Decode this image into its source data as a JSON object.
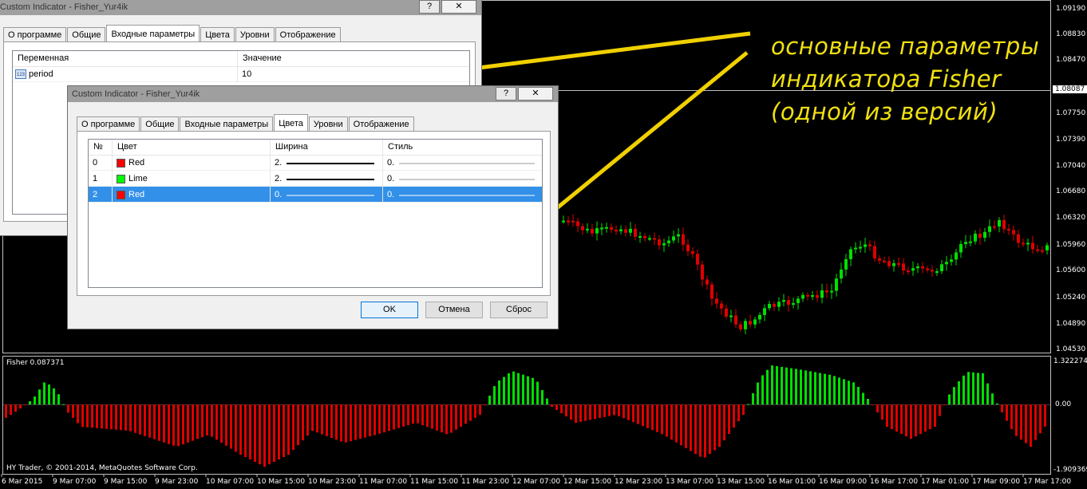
{
  "price_axis": [
    "1.09190",
    "1.08830",
    "1.08470",
    "1.08087",
    "1.07750",
    "1.07390",
    "1.07040",
    "1.06680",
    "1.06320",
    "1.05960",
    "1.05600",
    "1.05240",
    "1.04890",
    "1.04530"
  ],
  "indicator": {
    "label": "Fisher 0.087371",
    "scale_top": "1.322274",
    "scale_zero": "0.00",
    "scale_bottom": "-1.909369",
    "footer": "HY Trader, © 2001-2014, MetaQuotes Software Corp."
  },
  "time_axis": [
    "6 Mar 2015",
    "9 Mar 07:00",
    "9 Mar 15:00",
    "9 Mar 23:00",
    "10 Mar 07:00",
    "10 Mar 15:00",
    "10 Mar 23:00",
    "11 Mar 07:00",
    "11 Mar 15:00",
    "11 Mar 23:00",
    "12 Mar 07:00",
    "12 Mar 15:00",
    "12 Mar 23:00",
    "13 Mar 07:00",
    "13 Mar 15:00",
    "16 Mar 01:00",
    "16 Mar 09:00",
    "16 Mar 17:00",
    "17 Mar 01:00",
    "17 Mar 09:00",
    "17 Mar 17:00"
  ],
  "annotation": {
    "line1": "основные параметры",
    "line2": "индикатора Fisher",
    "line3": "(одной из версий)"
  },
  "colors": {
    "annotation": "#f0e010",
    "bull_candle": "#00e000",
    "bear_candle": "#e00000",
    "selection": "#3390e8"
  },
  "dialog_back": {
    "title": "Custom Indicator - Fisher_Yur4ik",
    "help_button": "?",
    "close_button": "✕",
    "tabs": [
      "О программе",
      "Общие",
      "Входные параметры",
      "Цвета",
      "Уровни",
      "Отображение"
    ],
    "active_tab": "Входные параметры",
    "col_variable": "Переменная",
    "col_value": "Значение",
    "params": [
      {
        "icon": "123",
        "name": "period",
        "value": "10"
      }
    ]
  },
  "dialog_front": {
    "title": "Custom Indicator - Fisher_Yur4ik",
    "help_button": "?",
    "close_button": "✕",
    "tabs": [
      "О программе",
      "Общие",
      "Входные параметры",
      "Цвета",
      "Уровни",
      "Отображение"
    ],
    "active_tab": "Цвета",
    "columns": [
      "№",
      "Цвет",
      "Ширина",
      "Стиль"
    ],
    "rows": [
      {
        "num": "0",
        "color_name": "Red",
        "color_hex": "#ff0000",
        "width": "2.",
        "style": "0.",
        "selected": false
      },
      {
        "num": "1",
        "color_name": "Lime",
        "color_hex": "#00ff00",
        "width": "2.",
        "style": "0.",
        "selected": false
      },
      {
        "num": "2",
        "color_name": "Red",
        "color_hex": "#ff0000",
        "width": "0.",
        "style": "0.",
        "selected": true
      }
    ],
    "ok_label": "OK",
    "cancel_label": "Отмена",
    "reset_label": "Сброс"
  }
}
